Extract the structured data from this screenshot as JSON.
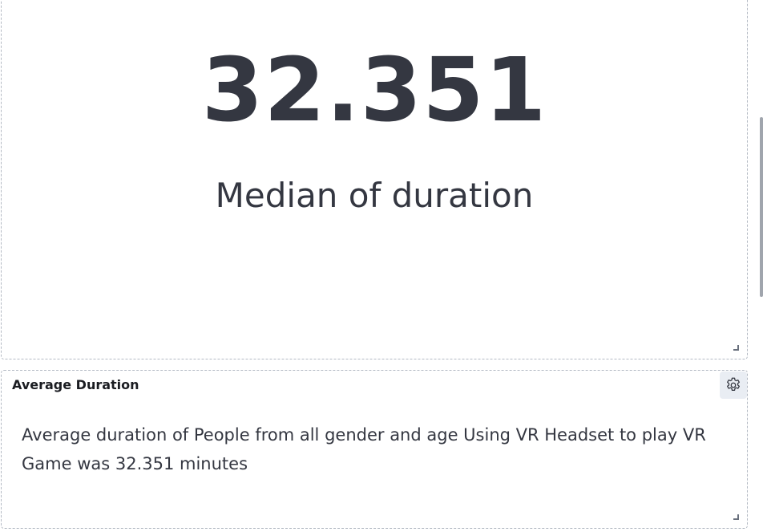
{
  "metric_panel": {
    "value": "32.351",
    "label": "Median of duration"
  },
  "text_panel": {
    "title": "Average Duration",
    "body": "Average duration of People from all gender and age Using VR Headset to play VR Game was 32.351 minutes",
    "settings_icon": "gear-icon"
  },
  "colors": {
    "text_primary": "#343741",
    "panel_border": "#b4bac4",
    "button_bg": "#e9edf3"
  }
}
